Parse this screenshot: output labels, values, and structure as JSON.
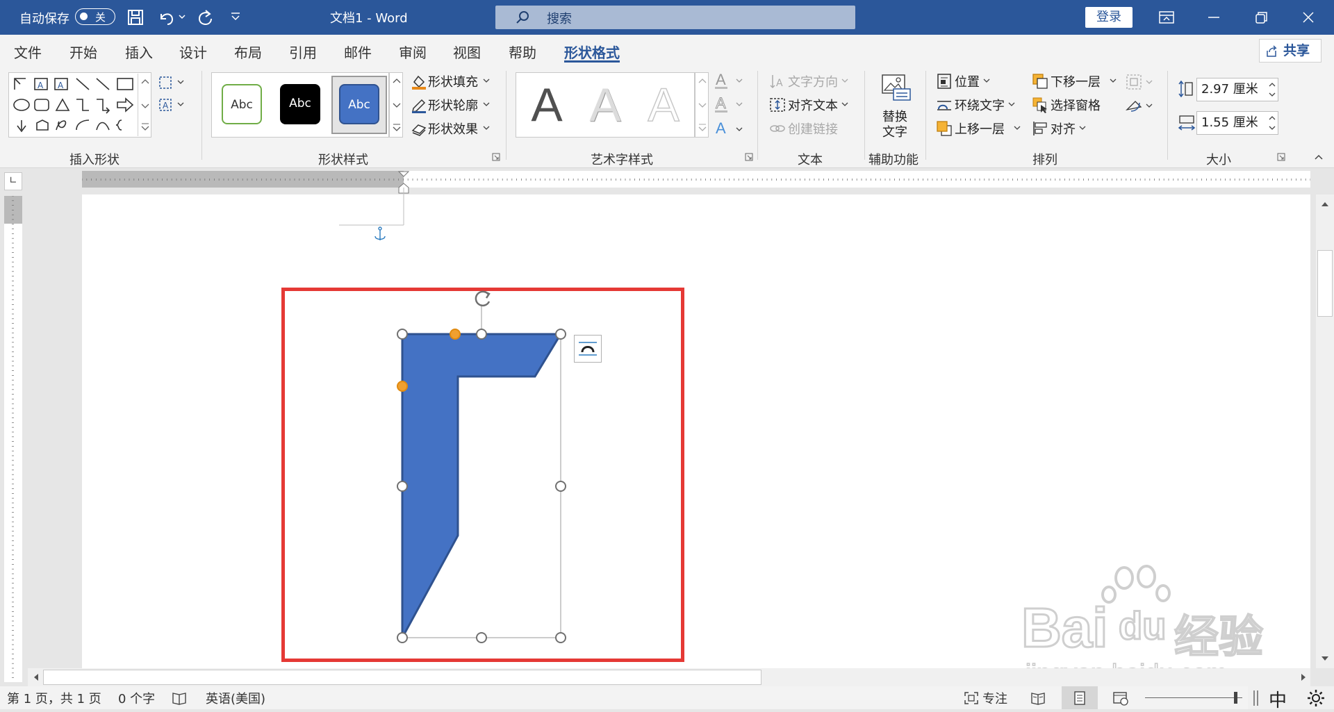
{
  "titlebar": {
    "autosave_label": "自动保存",
    "autosave_state": "关",
    "doc_title": "文档1  -  Word",
    "search_placeholder": "搜索",
    "login_label": "登录"
  },
  "tabs": [
    {
      "label": "文件"
    },
    {
      "label": "开始"
    },
    {
      "label": "插入"
    },
    {
      "label": "设计"
    },
    {
      "label": "布局"
    },
    {
      "label": "引用"
    },
    {
      "label": "邮件"
    },
    {
      "label": "审阅"
    },
    {
      "label": "视图"
    },
    {
      "label": "帮助"
    },
    {
      "label": "形状格式",
      "active": true
    }
  ],
  "share_label": "共享",
  "ribbon": {
    "insert_shapes": {
      "label": "插入形状"
    },
    "shape_styles": {
      "label": "形状样式",
      "gallery": [
        "Abc",
        "Abc",
        "Abc"
      ],
      "fill": "形状填充",
      "outline": "形状轮廓",
      "effects": "形状效果"
    },
    "wordart": {
      "label": "艺术字样式",
      "gallery": [
        "A",
        "A",
        "A"
      ]
    },
    "text": {
      "label": "文本",
      "direction": "文字方向",
      "align": "对齐文本",
      "link": "创建链接"
    },
    "accessibility": {
      "label": "辅助功能",
      "alt_text_line1": "替换",
      "alt_text_line2": "文字"
    },
    "arrange": {
      "label": "排列",
      "position": "位置",
      "wrap": "环绕文字",
      "forward": "上移一层",
      "backward": "下移一层",
      "pane": "选择窗格",
      "align": "对齐"
    },
    "size": {
      "label": "大小",
      "height": "2.97 厘米",
      "width": "1.55 厘米"
    }
  },
  "statusbar": {
    "page": "第 1 页，共 1 页",
    "words": "0 个字",
    "language": "英语(美国)",
    "focus": "专注",
    "ime": "中"
  },
  "watermark": {
    "brand": "Bai",
    "brand2": "du",
    "product": "经验",
    "url": "jingyan.baidu.com"
  },
  "colors": {
    "title_bar": "#2b579a",
    "shape_fill": "#4472c4",
    "shape_outline": "#2f528f",
    "highlight_box": "#e53935"
  }
}
